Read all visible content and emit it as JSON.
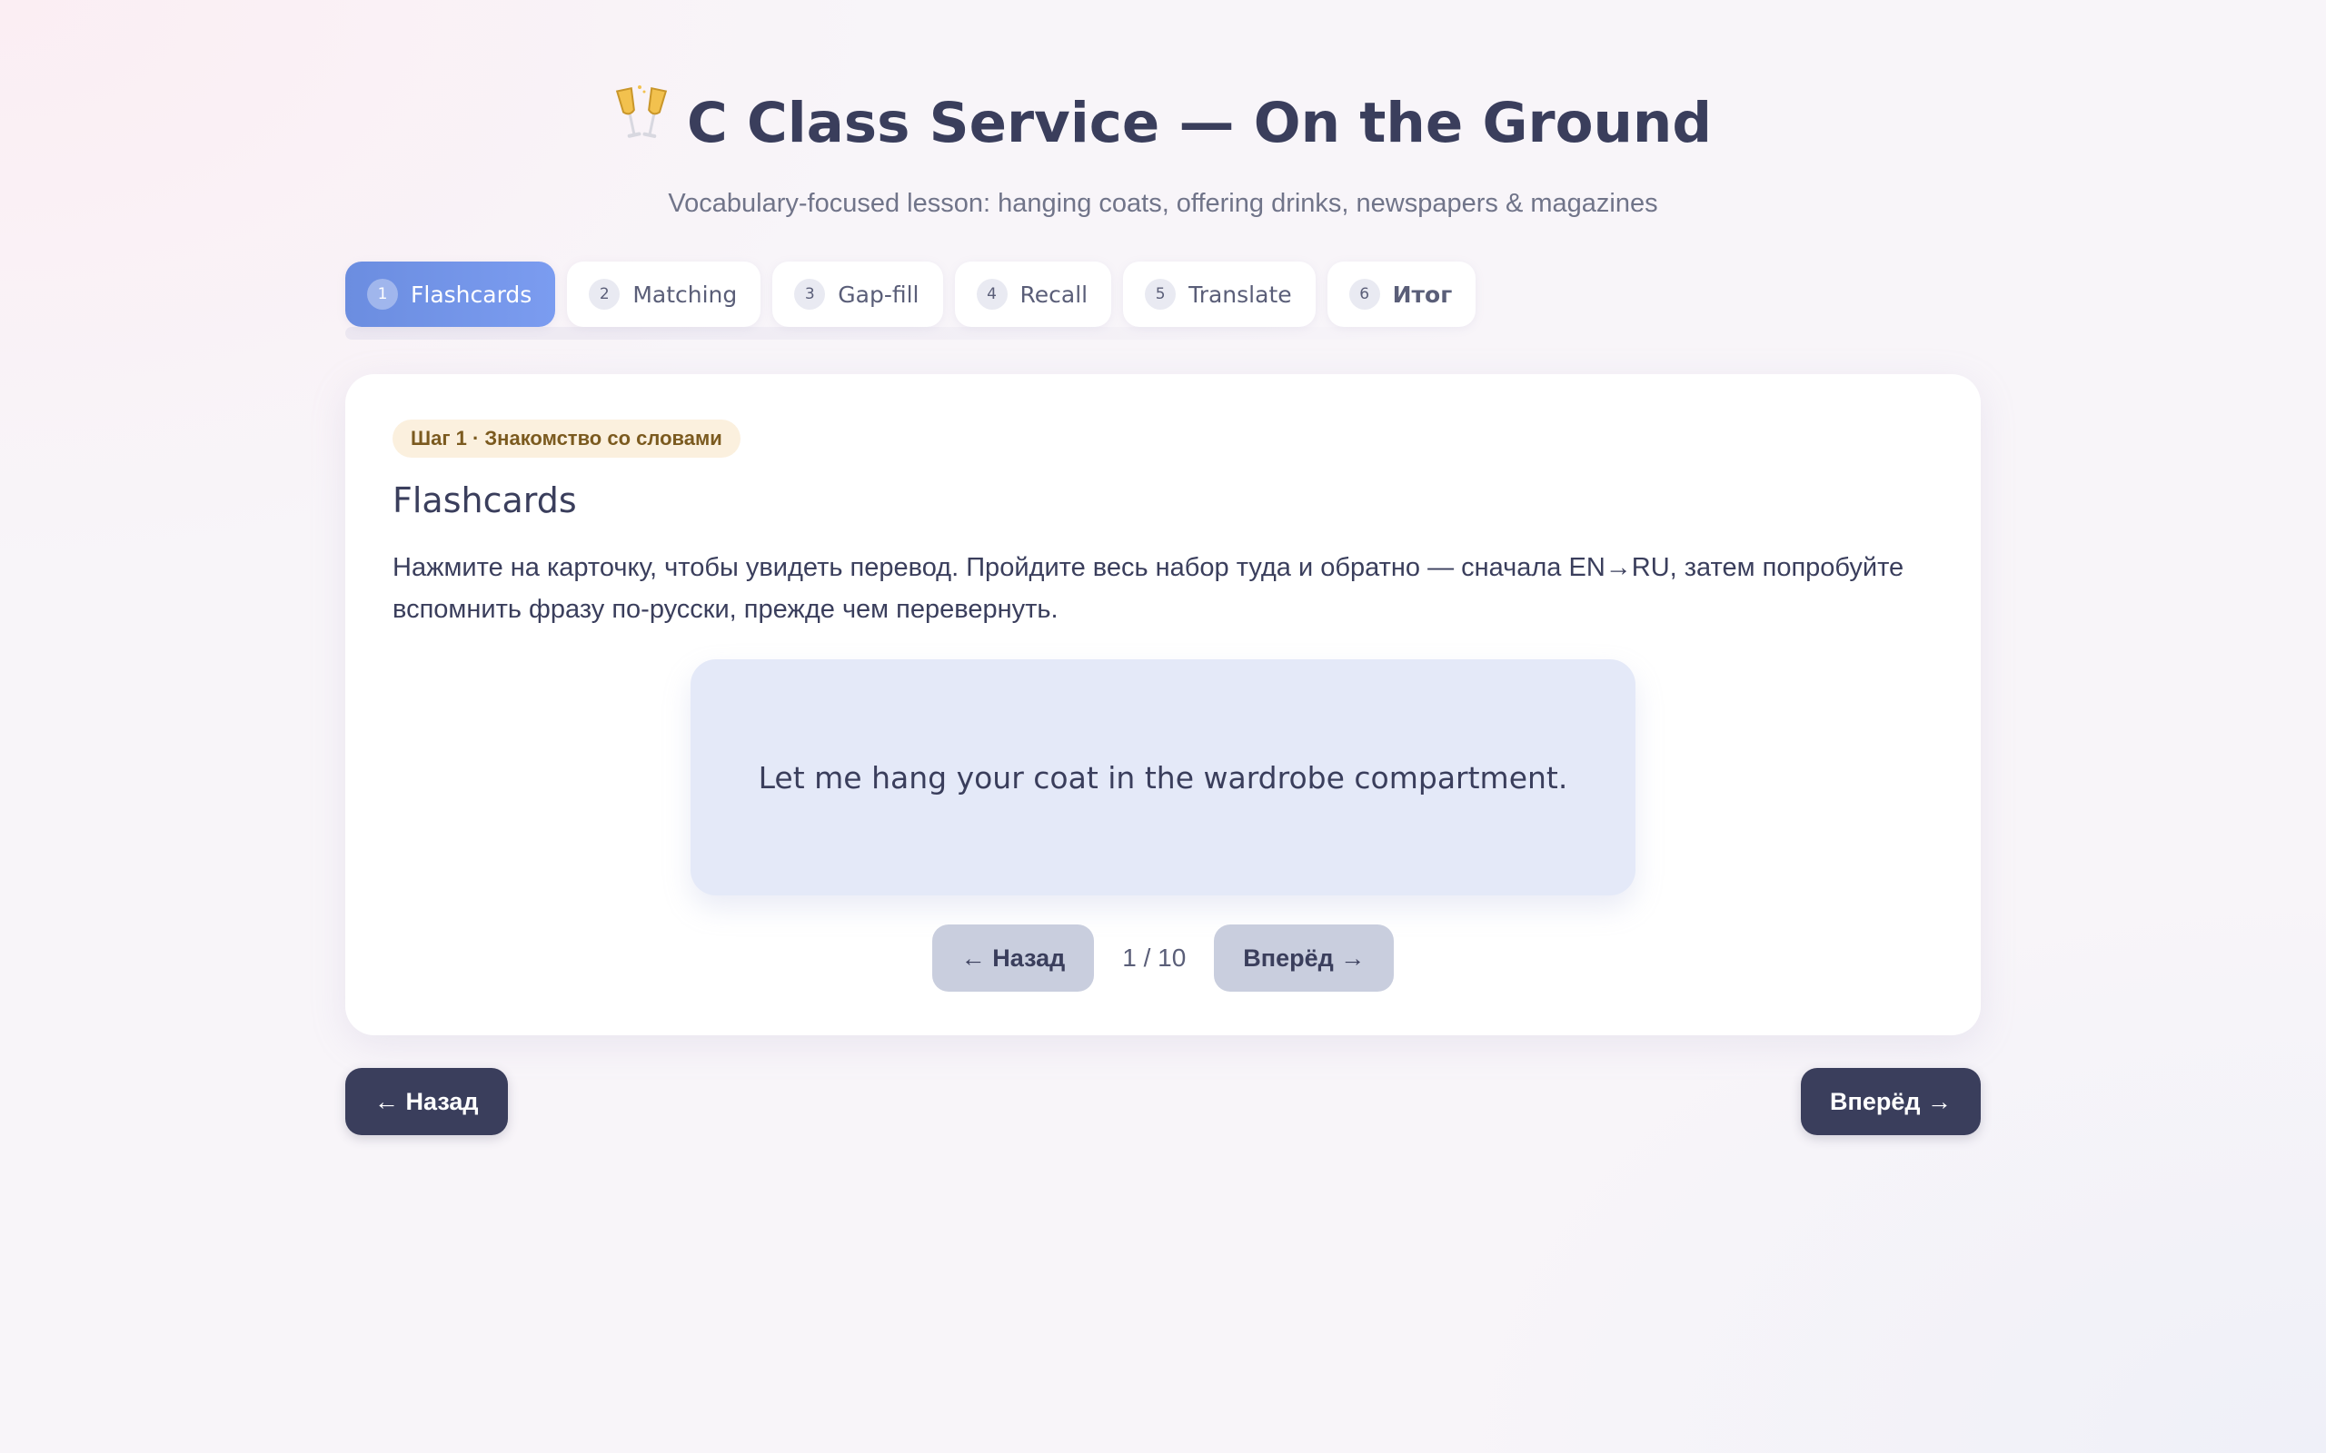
{
  "header": {
    "icon": "champagne-glasses-icon",
    "title": "C Class Service — On the Ground",
    "subtitle": "Vocabulary-focused lesson: hanging coats, offering drinks, newspapers & magazines"
  },
  "tabs": [
    {
      "num": "1",
      "label": "Flashcards",
      "active": true
    },
    {
      "num": "2",
      "label": "Matching"
    },
    {
      "num": "3",
      "label": "Gap-fill"
    },
    {
      "num": "4",
      "label": "Recall"
    },
    {
      "num": "5",
      "label": "Translate"
    },
    {
      "num": "6",
      "label": "Итог"
    }
  ],
  "step": {
    "badge": "Шаг 1 · Знакомство со словами",
    "title": "Flashcards",
    "instructions": "Нажмите на карточку, чтобы увидеть перевод. Пройдите весь набор туда и обратно — сначала EN→RU, затем попробуйте вспомнить фразу по-русски, прежде чем перевернуть."
  },
  "flashcard": {
    "text": "Let me hang your coat in the wardrobe compartment.",
    "prev_label": "← Назад",
    "next_label": "Вперёд →",
    "counter": "1 / 10"
  },
  "footer_nav": {
    "prev_label": "← Назад",
    "next_label": "Вперёд →"
  },
  "colors": {
    "accent": "#6b8de0",
    "dark": "#3a3e5c",
    "card_face": "#e4e9f8",
    "badge_bg": "#fbf0de"
  }
}
